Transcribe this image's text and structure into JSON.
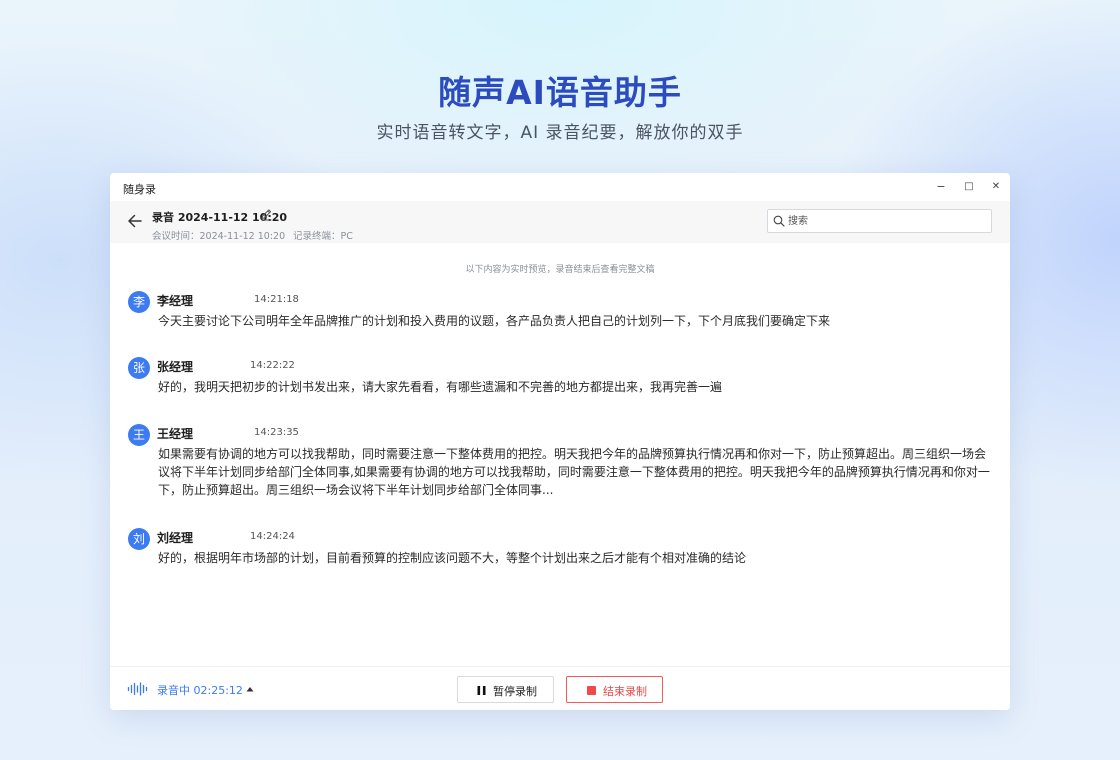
{
  "hero": {
    "title": "随声AI语音助手",
    "subtitle": "实时语音转文字，AI 录音纪要，解放你的双手"
  },
  "window": {
    "app_name": "随身录",
    "controls": [
      "−",
      "□",
      "✕"
    ]
  },
  "header": {
    "title": "录音 2024-11-12 10:20",
    "meeting_time": "会议时间：2024-11-12 10:20",
    "device": "记录终端：PC",
    "search_placeholder": "搜索"
  },
  "notice": "以下内容为实时预览，录音结束后查看完整文稿",
  "messages": [
    {
      "avatar": "李",
      "speaker": "李经理",
      "time": "14:21:18",
      "text": "今天主要讨论下公司明年全年品牌推广的计划和投入费用的议题，各产品负责人把自己的计划列一下，下个月底我们要确定下来"
    },
    {
      "avatar": "张",
      "speaker": "张经理",
      "time": "14:22:22",
      "text": "好的，我明天把初步的计划书发出来，请大家先看看，有哪些遗漏和不完善的地方都提出来，我再完善一遍"
    },
    {
      "avatar": "王",
      "speaker": "王经理",
      "time": "14:23:35",
      "text": "如果需要有协调的地方可以找我帮助，同时需要注意一下整体费用的把控。明天我把今年的品牌预算执行情况再和你对一下，防止预算超出。周三组织一场会议将下半年计划同步给部门全体同事,如果需要有协调的地方可以找我帮助，同时需要注意一下整体费用的把控。明天我把今年的品牌预算执行情况再和你对一下，防止预算超出。周三组织一场会议将下半年计划同步给部门全体同事..."
    },
    {
      "avatar": "刘",
      "speaker": "刘经理",
      "time": "14:24:24",
      "text": "好的，根据明年市场部的计划，目前看预算的控制应该问题不大，等整个计划出来之后才能有个相对准确的结论"
    }
  ],
  "footer": {
    "status": "录音中 02:25:12",
    "pause_label": "暂停录制",
    "stop_label": "结束录制"
  },
  "colors": {
    "accent": "#3d7bf2",
    "title": "#2b4bbf",
    "stop": "#e84848"
  }
}
